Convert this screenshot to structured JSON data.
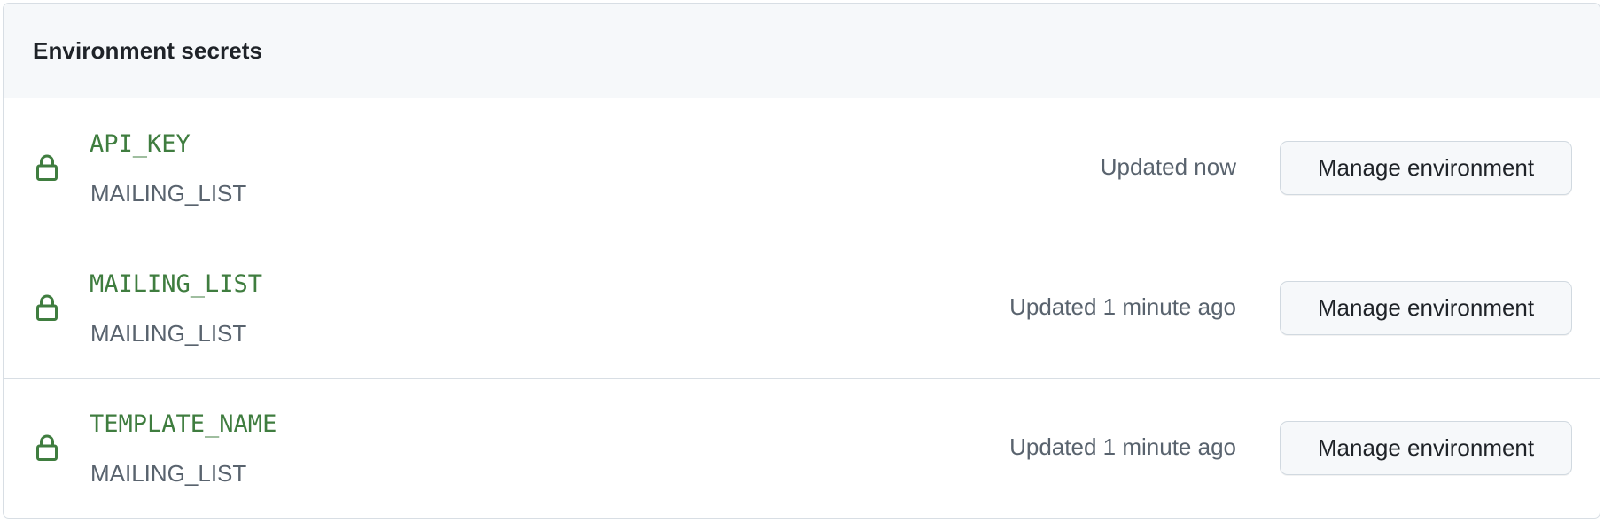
{
  "header": {
    "title": "Environment secrets"
  },
  "colors": {
    "secret_name": "#3f7d3f",
    "lock_icon": "#3f7d3f",
    "muted_text": "#59636e",
    "border": "#d8dee4",
    "header_bg": "#f6f8fa"
  },
  "secrets": [
    {
      "icon": "lock-icon",
      "name": "API_KEY",
      "environment": "MAILING_LIST",
      "updated": "Updated now",
      "action_label": "Manage environment"
    },
    {
      "icon": "lock-icon",
      "name": "MAILING_LIST",
      "environment": "MAILING_LIST",
      "updated": "Updated 1 minute ago",
      "action_label": "Manage environment"
    },
    {
      "icon": "lock-icon",
      "name": "TEMPLATE_NAME",
      "environment": "MAILING_LIST",
      "updated": "Updated 1 minute ago",
      "action_label": "Manage environment"
    }
  ]
}
